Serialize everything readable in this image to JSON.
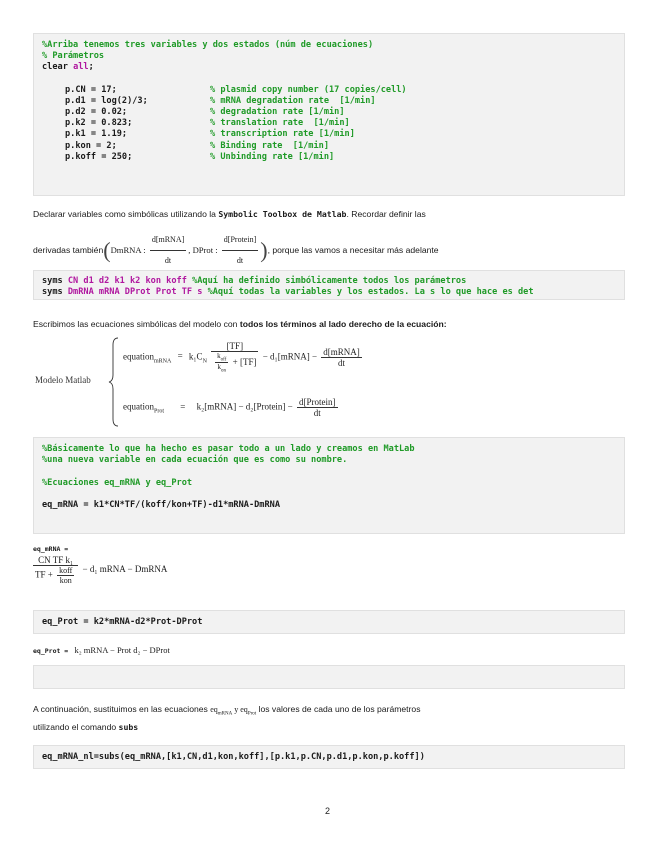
{
  "block1": {
    "comment1": "%Arriba tenemos tres variables y dos estados (núm de ecuaciones)",
    "comment2": "% Parámetros",
    "clear": "clear",
    "all": "all",
    "semi": ";",
    "params": [
      {
        "code": "p.CN = 17;",
        "comment": "% plasmid copy number (17 copies/cell)"
      },
      {
        "code": "p.d1 = log(2)/3;",
        "comment": "% mRNA degradation rate  [1/min]"
      },
      {
        "code": "p.d2 = 0.02;",
        "comment": "% degradation rate [1/min]"
      },
      {
        "code": "p.k2 = 0.823;",
        "comment": "% translation rate  [1/min]"
      },
      {
        "code": "p.k1 = 1.19;",
        "comment": "% transcription rate [1/min]"
      },
      {
        "code": "p.kon = 2;",
        "comment": "% Binding rate  [1/min]"
      },
      {
        "code": "p.koff = 250;",
        "comment": "% Unbinding rate [1/min]"
      }
    ]
  },
  "para1": {
    "line1_a": "Declarar variables como simbólicas utilizando la ",
    "line1_code": "Symbolic Toolbox de Matlab",
    "line1_b": ". Recordar definir las",
    "line2_a": "derivadas también",
    "line2_b": ", porque las vamos a necesitar más adelante",
    "m_dmrna": "DmRNA",
    "m_num1": "d[mRNA]",
    "m_dt": "dt",
    "m_dprot": "DProt",
    "m_num2": "d[Protein]"
  },
  "block2": {
    "syms": "syms",
    "line1_vars": " CN d1 d2 k1 k2 kon koff ",
    "line1_comment": "%Aquí ha definido simbólicamente todos los parámetros",
    "line2_vars": " DmRNA mRNA DProt Prot TF s ",
    "line2_comment": "%Aquí todas la variables y los estados. La s lo que hace es det"
  },
  "para2": {
    "text": "Escribimos las ecuaciones simbólicas del modelo con ",
    "bold": "todos los términos al lado derecho de la ecuación:"
  },
  "model": {
    "label": "Modelo Matlab",
    "eq1_name": "equation",
    "eq1_sub": "mRNA",
    "eq1_k1cn": "k₁C",
    "eq1_cn_sub": "N",
    "eq1_tf": "[TF]",
    "eq1_koff": "k",
    "eq1_koff_sub": "off",
    "eq1_kon": "k",
    "eq1_kon_sub": "on",
    "eq1_plus_tf": "+ [TF]",
    "eq1_d1": "− d₁[mRNA] −",
    "eq1_num": "d[mRNA]",
    "eq1_dt": "dt",
    "eq_eq": "=",
    "eq2_name": "equation",
    "eq2_sub": "Prot",
    "eq2_body": "k₂[mRNA] − d₂[Protein] −",
    "eq2_num": "d[Protein]",
    "eq2_dt": "dt"
  },
  "block3": {
    "c1": "%Básicamente lo que ha hecho es pasar todo a un lado y creamos en MatLab",
    "c2": "%una nueva variable en cada ecuación que es como su nombre.",
    "c3": "%Ecuaciones eq_mRNA y eq_Prot",
    "code": "eq_mRNA = k1*CN*TF/(koff/kon+TF)-d1*mRNA-DmRNA"
  },
  "out1": {
    "label": "eq_mRNA =",
    "num": "CN TF k₁",
    "den_a": "TF +",
    "den_num": "koff",
    "den_den": "kon",
    "rest": "− d₁ mRNA − DmRNA"
  },
  "block4": {
    "code": "eq_Prot = k2*mRNA-d2*Prot-DProt"
  },
  "out2": {
    "label": "eq_Prot =",
    "expr": "k₂ mRNA − Prot d₂ − DProt"
  },
  "para3": {
    "line1_a": "A continuación, sustituimos en las ecuaciones ",
    "eq_a": "eq",
    "eq_a_sub": "mRNA",
    "y": " y ",
    "eq_b": "eq",
    "eq_b_sub": "Prot",
    "line1_b": " los valores de cada uno de los parámetros",
    "line2_a": "utilizando el comando ",
    "line2_code": "subs"
  },
  "block6": {
    "code": "eq_mRNA_nl=subs(eq_mRNA,[k1,CN,d1,kon,koff],[p.k1,p.CN,p.d1,p.kon,p.koff])"
  },
  "page_number": "2"
}
